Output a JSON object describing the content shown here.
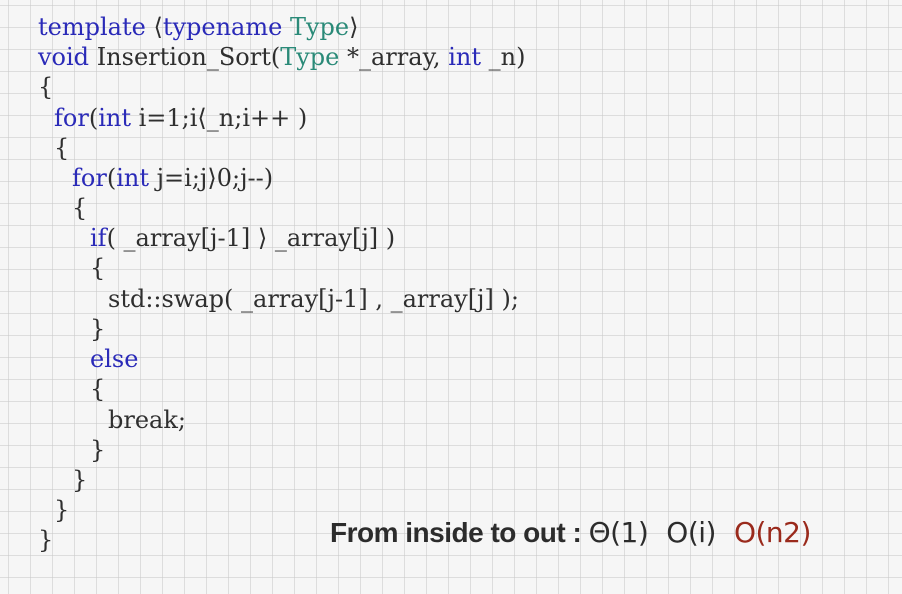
{
  "code_lines": {
    "l1": {
      "kw1": "template",
      "sep": " ",
      "p1": "⟨",
      "kw2": "typename",
      "ty": "Type",
      "p2": "⟩"
    },
    "l2": {
      "kw1": "void",
      "t1": "Insertion_Sort(",
      "ty": "Type",
      "t2": "*_array, ",
      "kw2": "int",
      "t3": " _n)"
    },
    "l3": "{",
    "l4": {
      "kw": "for",
      "t1": "(",
      "kw2": "int",
      "t2": " i=1;i⟨_n;i++ )"
    },
    "l5": "{",
    "l6": {
      "kw": "for",
      "t1": "(",
      "kw2": "int",
      "t2": " j=i;j⟩0;j--)"
    },
    "l7": "{",
    "l8": {
      "kw": "if",
      "t1": "( _array[j-1] ⟩ _array[j] )"
    },
    "l9": "{",
    "l10": "std::swap( _array[j-1] , _array[j] );",
    "l11": "}",
    "l12": {
      "kw": "else"
    },
    "l13": "{",
    "l14": "break;",
    "l15": "}",
    "l16": "}",
    "l17": "}",
    "l18": "}"
  },
  "complexity": {
    "label": "From inside to out :",
    "theta": "Θ(1)",
    "o_i": "O(i)",
    "o_n2": "O(n2)"
  },
  "colors": {
    "keyword": "#2a2ab8",
    "type": "#2a8a78",
    "highlight": "#9a2a1c"
  }
}
